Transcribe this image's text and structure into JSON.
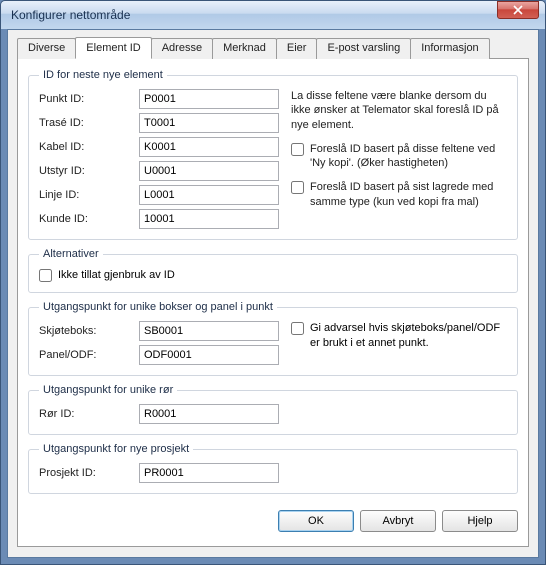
{
  "window": {
    "title": "Konfigurer nettområde"
  },
  "tabs": {
    "diverse": "Diverse",
    "element_id": "Element ID",
    "adresse": "Adresse",
    "merknad": "Merknad",
    "eier": "Eier",
    "epost": "E-post varsling",
    "informasjon": "Informasjon"
  },
  "group_next_id": {
    "legend": "ID for neste nye element",
    "punkt_label": "Punkt ID:",
    "punkt_value": "P0001",
    "trase_label": "Trasé ID:",
    "trase_value": "T0001",
    "kabel_label": "Kabel ID:",
    "kabel_value": "K0001",
    "utstyr_label": "Utstyr ID:",
    "utstyr_value": "U0001",
    "linje_label": "Linje ID:",
    "linje_value": "L0001",
    "kunde_label": "Kunde ID:",
    "kunde_value": "10001",
    "note": "La disse feltene være blanke dersom du ikke ønsker at Telemator skal foreslå ID på nye element.",
    "chk_ny_kopi": "Foreslå ID basert på disse feltene ved 'Ny kopi'. (Øker hastigheten)",
    "chk_sist_lagrede": "Foreslå ID basert på sist lagrede med samme type (kun ved kopi fra mal)"
  },
  "group_alt": {
    "legend": "Alternativer",
    "chk_reuse": "Ikke tillat gjenbruk av ID"
  },
  "group_boks": {
    "legend": "Utgangspunkt for unike bokser og panel i punkt",
    "skjoteboks_label": "Skjøteboks:",
    "skjoteboks_value": "SB0001",
    "panel_label": "Panel/ODF:",
    "panel_value": "ODF0001",
    "chk_warn": "Gi advarsel hvis skjøteboks/panel/ODF er brukt i et annet punkt."
  },
  "group_ror": {
    "legend": "Utgangspunkt for unike rør",
    "ror_label": "Rør ID:",
    "ror_value": "R0001"
  },
  "group_prosjekt": {
    "legend": "Utgangspunkt for nye prosjekt",
    "prosjekt_label": "Prosjekt ID:",
    "prosjekt_value": "PR0001"
  },
  "buttons": {
    "ok": "OK",
    "avbryt": "Avbryt",
    "hjelp": "Hjelp"
  }
}
